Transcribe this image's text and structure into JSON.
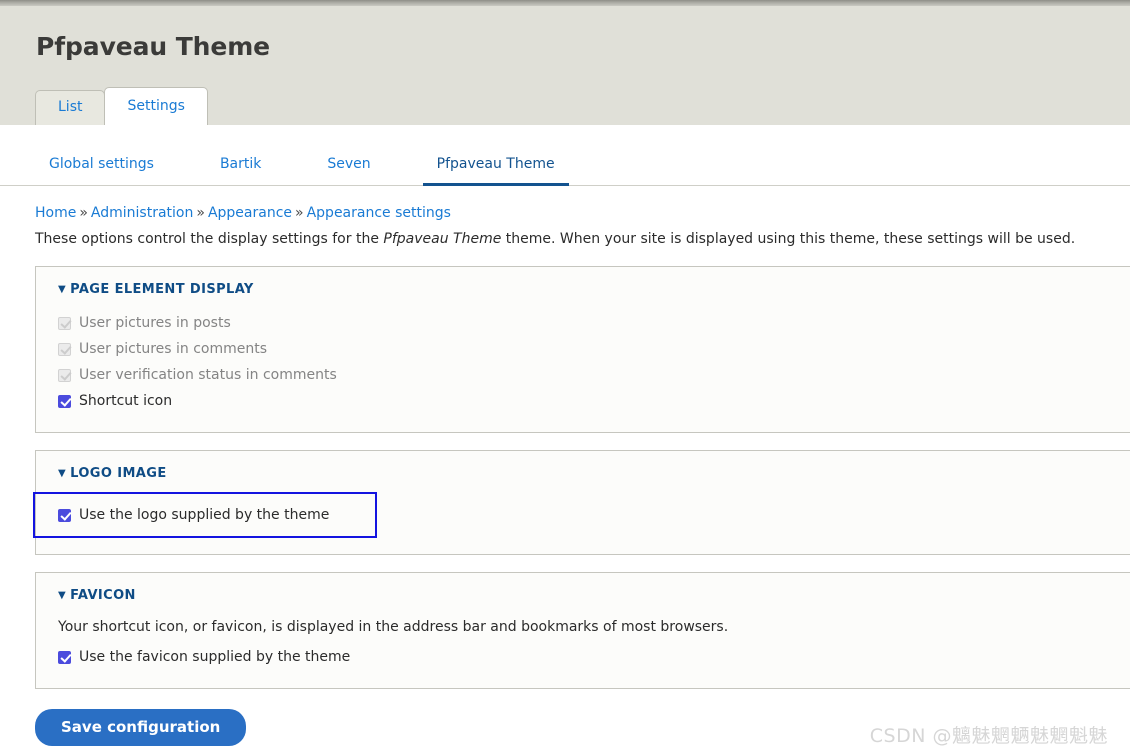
{
  "header": {
    "title": "Pfpaveau Theme"
  },
  "primary_tabs": [
    {
      "label": "List",
      "active": false
    },
    {
      "label": "Settings",
      "active": true
    }
  ],
  "secondary_tabs": [
    {
      "label": "Global settings",
      "active": false
    },
    {
      "label": "Bartik",
      "active": false
    },
    {
      "label": "Seven",
      "active": false
    },
    {
      "label": "Pfpaveau Theme",
      "active": true
    }
  ],
  "breadcrumb": {
    "separator": "»",
    "items": [
      {
        "label": "Home"
      },
      {
        "label": "Administration"
      },
      {
        "label": "Appearance"
      },
      {
        "label": "Appearance settings"
      }
    ]
  },
  "description": {
    "before": "These options control the display settings for the ",
    "emphasis": "Pfpaveau Theme",
    "after": " theme. When your site is displayed using this theme, these settings will be used."
  },
  "fieldsets": [
    {
      "legend": "PAGE ELEMENT DISPLAY",
      "triangle": "▼",
      "help": "",
      "checkboxes": [
        {
          "label": "User pictures in posts",
          "checked": true,
          "disabled": true,
          "focused": false
        },
        {
          "label": "User pictures in comments",
          "checked": true,
          "disabled": true,
          "focused": false
        },
        {
          "label": "User verification status in comments",
          "checked": true,
          "disabled": true,
          "focused": false
        },
        {
          "label": "Shortcut icon",
          "checked": true,
          "disabled": false,
          "focused": false
        }
      ]
    },
    {
      "legend": "LOGO IMAGE",
      "triangle": "▼",
      "help": "",
      "checkboxes": [
        {
          "label": "Use the logo supplied by the theme",
          "checked": true,
          "disabled": false,
          "focused": true
        }
      ]
    },
    {
      "legend": "FAVICON",
      "triangle": "▼",
      "help": "Your shortcut icon, or favicon, is displayed in the address bar and bookmarks of most browsers.",
      "checkboxes": [
        {
          "label": "Use the favicon supplied by the theme",
          "checked": true,
          "disabled": false,
          "focused": false
        }
      ]
    }
  ],
  "actions": {
    "save_label": "Save configuration"
  },
  "watermark": {
    "brand": "CSDN ",
    "handle": "@魑魅魍魉魅魍魁魅"
  },
  "colors": {
    "header_band": "#e0e0d8",
    "link": "#1a7bd4",
    "legend": "#0f4c85",
    "checkbox_checked": "#4b4bdd",
    "focus_outline": "#1414e0",
    "button": "#2a6fc4"
  }
}
